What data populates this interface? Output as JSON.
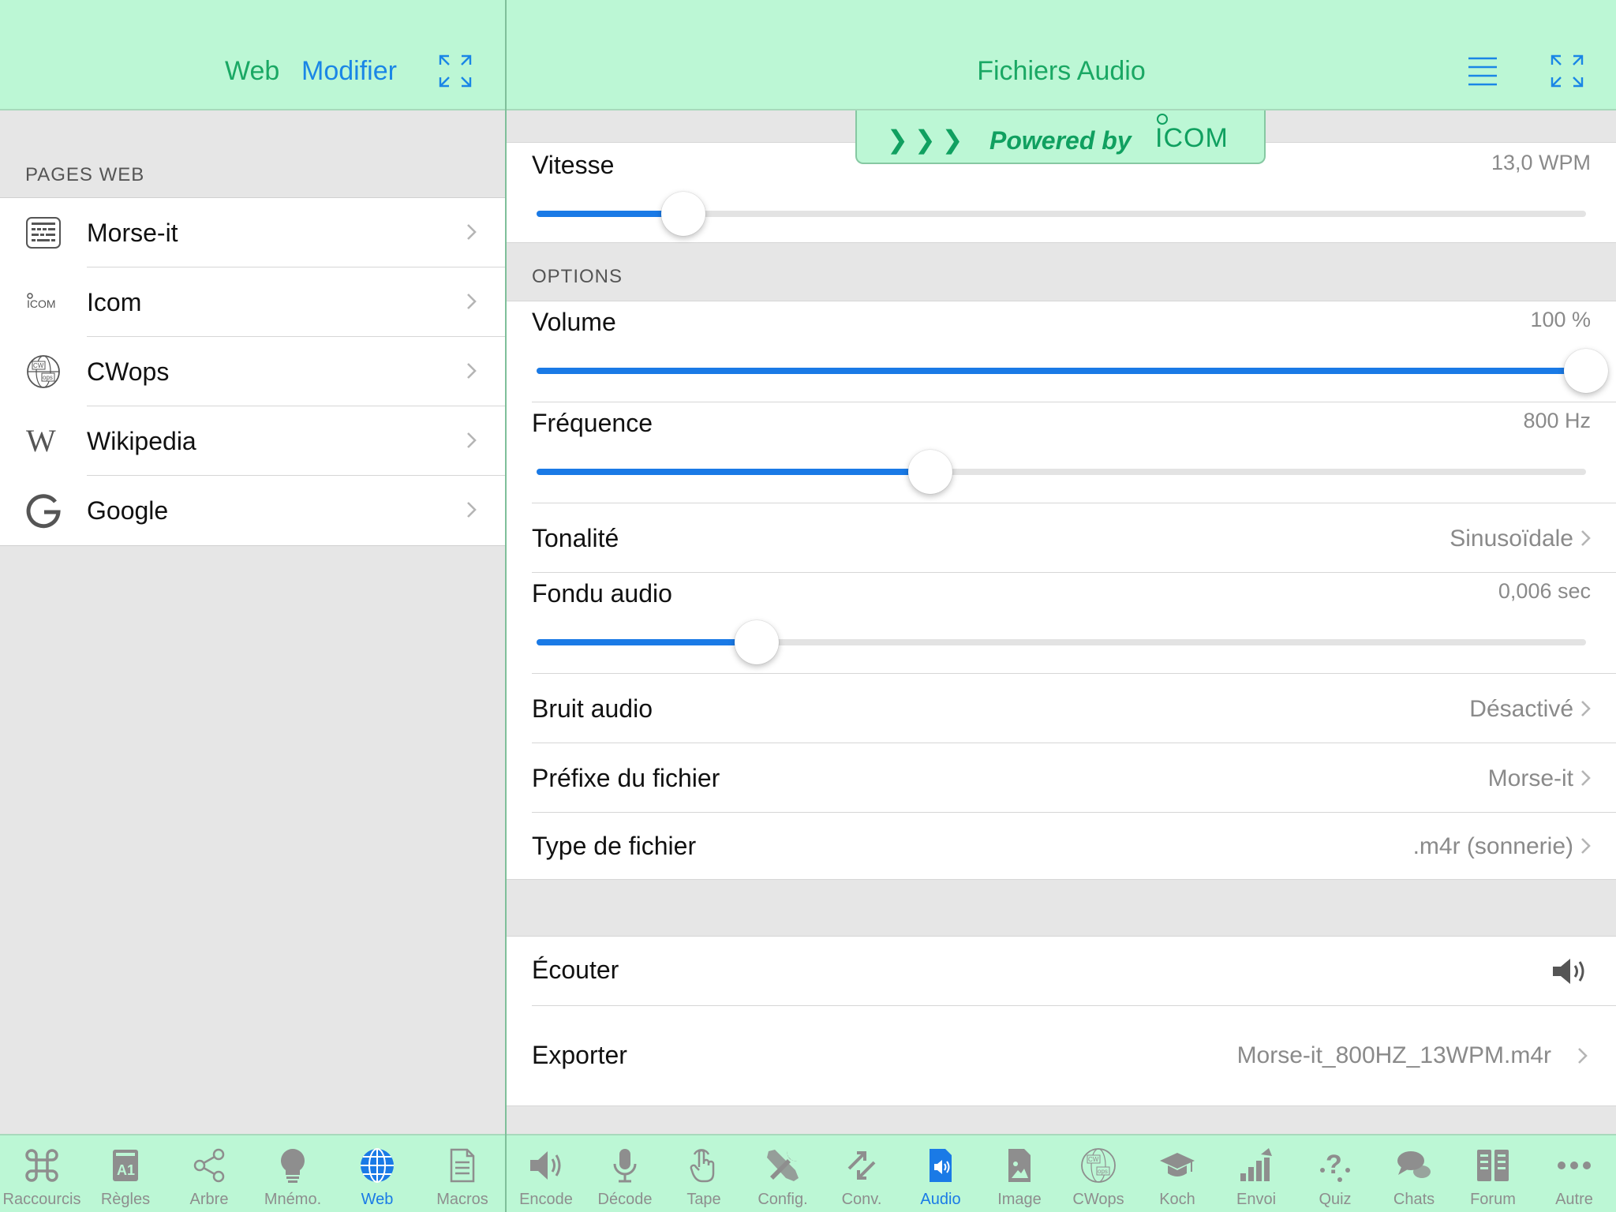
{
  "left_header": {
    "title": "Web",
    "edit_label": "Modifier"
  },
  "right_header": {
    "title": "Fichiers Audio"
  },
  "powered": {
    "text": "Powered by",
    "brand": "ICOM"
  },
  "web_pages": {
    "section_label": "PAGES WEB",
    "items": [
      {
        "label": "Morse-it",
        "icon": "keyboard-icon"
      },
      {
        "label": "Icom",
        "icon": "icom-logo-icon"
      },
      {
        "label": "CWops",
        "icon": "cwops-globe-icon"
      },
      {
        "label": "Wikipedia",
        "icon": "wikipedia-w-icon"
      },
      {
        "label": "Google",
        "icon": "google-g-icon"
      }
    ]
  },
  "audio": {
    "vitesse": {
      "label": "Vitesse",
      "value": "13,0 WPM",
      "level": 0.14
    },
    "options_label": "OPTIONS",
    "volume": {
      "label": "Volume",
      "value": "100 %",
      "level": 1.0
    },
    "frequence": {
      "label": "Fréquence",
      "value": "800 Hz",
      "level": 0.375
    },
    "tonalite": {
      "label": "Tonalité",
      "value": "Sinusoïdale"
    },
    "fondu": {
      "label": "Fondu audio",
      "value": "0,006 sec",
      "level": 0.21
    },
    "bruit": {
      "label": "Bruit audio",
      "value": "Désactivé"
    },
    "prefixe": {
      "label": "Préfixe du fichier",
      "value": "Morse-it"
    },
    "type": {
      "label": "Type de fichier",
      "value": ".m4r (sonnerie)"
    },
    "ecouter": {
      "label": "Écouter"
    },
    "exporter": {
      "label": "Exporter",
      "value": "Morse-it_800HZ_13WPM.m4r"
    }
  },
  "tabs_left": [
    {
      "label": "Raccourcis",
      "icon": "command-icon"
    },
    {
      "label": "Règles",
      "icon": "rules-icon"
    },
    {
      "label": "Arbre",
      "icon": "tree-share-icon"
    },
    {
      "label": "Mnémo.",
      "icon": "lightbulb-icon"
    },
    {
      "label": "Web",
      "icon": "globe-icon",
      "active": true
    },
    {
      "label": "Macros",
      "icon": "document-icon"
    }
  ],
  "tabs_right": [
    {
      "label": "Encode",
      "icon": "speaker-icon"
    },
    {
      "label": "Décode",
      "icon": "microphone-icon"
    },
    {
      "label": "Tape",
      "icon": "hand-tap-icon"
    },
    {
      "label": "Config.",
      "icon": "tools-icon"
    },
    {
      "label": "Conv.",
      "icon": "convert-arrows-icon"
    },
    {
      "label": "Audio",
      "icon": "audio-file-icon",
      "active": true
    },
    {
      "label": "Image",
      "icon": "image-file-icon"
    },
    {
      "label": "CWops",
      "icon": "cwops-icon"
    },
    {
      "label": "Koch",
      "icon": "graduation-cap-icon"
    },
    {
      "label": "Envoi",
      "icon": "send-chart-icon"
    },
    {
      "label": "Quiz",
      "icon": "quiz-icon"
    },
    {
      "label": "Chats",
      "icon": "chat-bubbles-icon"
    },
    {
      "label": "Forum",
      "icon": "forum-icon"
    },
    {
      "label": "Autre",
      "icon": "more-icon"
    }
  ],
  "colors": {
    "header_bg": "#bcf7d5",
    "accent_green": "#1aa864",
    "accent_blue": "#1a7ae6"
  }
}
